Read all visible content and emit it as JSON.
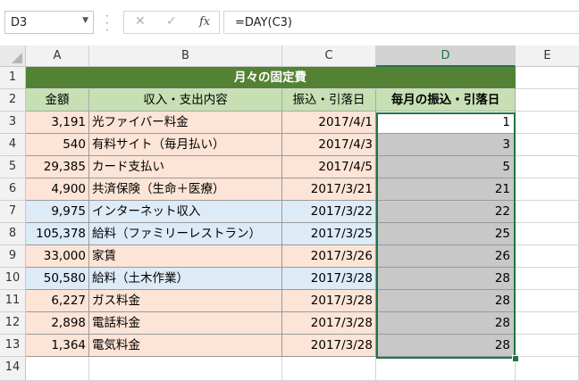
{
  "formula_bar": {
    "name_box": "D3",
    "cancel_icon": "✕",
    "enter_icon": "✓",
    "fx_label": "fx",
    "formula": "=DAY(C3)"
  },
  "columns": [
    "A",
    "B",
    "C",
    "D",
    "E"
  ],
  "rows": [
    "1",
    "2",
    "3",
    "4",
    "5",
    "6",
    "7",
    "8",
    "9",
    "10",
    "11",
    "12",
    "13",
    "14"
  ],
  "title": "月々の固定費",
  "headers": [
    "金額",
    "収入・支出内容",
    "振込・引落日",
    "毎月の振込・引落日"
  ],
  "data": [
    {
      "amount": "3,191",
      "item": "光ファイバー料金",
      "date": "2017/4/1",
      "day": "1",
      "color": "#fce4d6"
    },
    {
      "amount": "540",
      "item": "有料サイト（毎月払い）",
      "date": "2017/4/3",
      "day": "3",
      "color": "#fce4d6"
    },
    {
      "amount": "29,385",
      "item": "カード支払い",
      "date": "2017/4/5",
      "day": "5",
      "color": "#fce4d6"
    },
    {
      "amount": "4,900",
      "item": "共済保険（生命＋医療）",
      "date": "2017/3/21",
      "day": "21",
      "color": "#fce4d6"
    },
    {
      "amount": "9,975",
      "item": "インターネット収入",
      "date": "2017/3/22",
      "day": "22",
      "color": "#ddebf7"
    },
    {
      "amount": "105,378",
      "item": "給料（ファミリーレストラン）",
      "date": "2017/3/25",
      "day": "25",
      "color": "#ddebf7"
    },
    {
      "amount": "33,000",
      "item": "家賃",
      "date": "2017/3/26",
      "day": "26",
      "color": "#fce4d6"
    },
    {
      "amount": "50,580",
      "item": "給料（土木作業）",
      "date": "2017/3/28",
      "day": "28",
      "color": "#ddebf7"
    },
    {
      "amount": "6,227",
      "item": "ガス料金",
      "date": "2017/3/28",
      "day": "28",
      "color": "#fce4d6"
    },
    {
      "amount": "2,898",
      "item": "電話料金",
      "date": "2017/3/28",
      "day": "28",
      "color": "#fce4d6"
    },
    {
      "amount": "1,364",
      "item": "電気料金",
      "date": "2017/3/28",
      "day": "28",
      "color": "#fce4d6"
    }
  ]
}
